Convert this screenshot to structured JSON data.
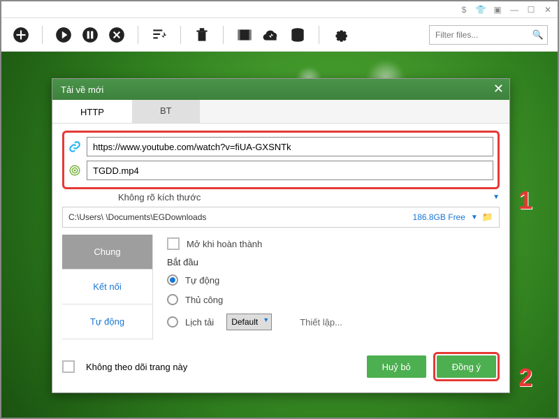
{
  "titlebar_icons": [
    "dollar",
    "tshirt",
    "restore",
    "minimize",
    "maximize",
    "close"
  ],
  "filter_placeholder": "Filter files...",
  "dialog": {
    "title": "Tải về mới",
    "tabs": {
      "http": "HTTP",
      "bt": "BT"
    },
    "url_value": "https://www.youtube.com/watch?v=fiUA-GXSNTk",
    "filename_value": "TGDD.mp4",
    "size_unknown": "Không rõ kích thước",
    "save_path": "C:\\Users\\            \\Documents\\EGDownloads",
    "free_space": "186.8GB Free",
    "side_tabs": {
      "general": "Chung",
      "connection": "Kết nối",
      "auto": "Tự động"
    },
    "open_when_done": "Mở khi hoàn thành",
    "start_heading": "Bắt đầu",
    "start_options": {
      "auto": "Tự động",
      "manual": "Thủ công",
      "schedule": "Lịch tải"
    },
    "schedule_default": "Default",
    "setup_label": "Thiết lập...",
    "no_track": "Không theo dõi trang này",
    "cancel": "Huỷ bỏ",
    "ok": "Đồng ý"
  },
  "callouts": {
    "c1": "1",
    "c2": "2"
  }
}
